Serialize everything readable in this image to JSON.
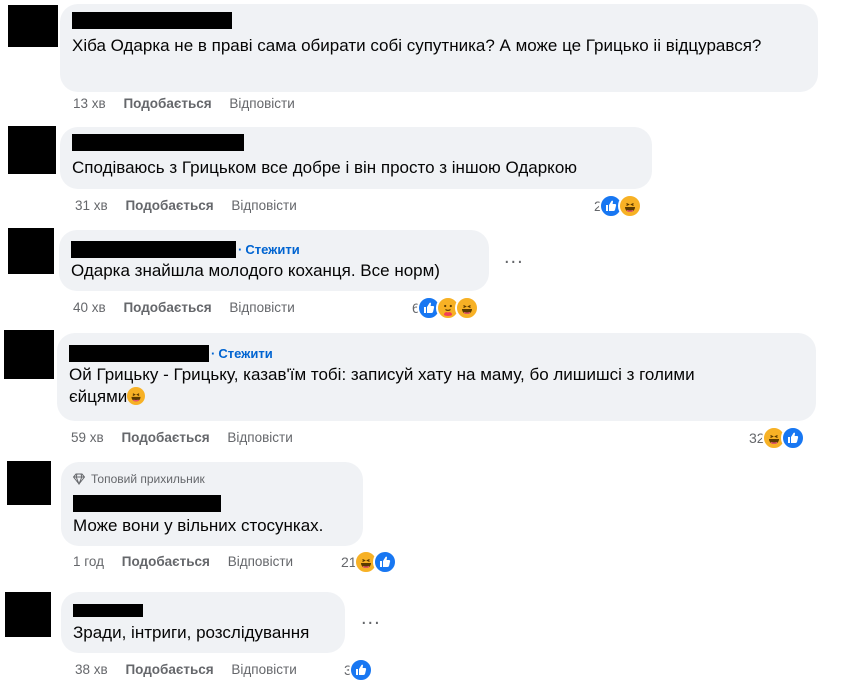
{
  "comments": [
    {
      "text": "Хіба Одарка не в праві сама обирати собі супутника? А може це Грицько іі відцурався?",
      "time": "13 хв",
      "like": "Подобається",
      "reply": "Відповісти"
    },
    {
      "text": "Сподіваюсь з Грицьком все добре і він просто з іншою Одаркою",
      "time": "31 хв",
      "like": "Подобається",
      "reply": "Відповісти",
      "reactions": {
        "count": "2",
        "icons": [
          "like-icon",
          "haha-icon"
        ]
      }
    },
    {
      "follow": "Стежити",
      "text": "Одарка знайшла молодого коханця. Все норм)",
      "time": "40 хв",
      "like": "Подобається",
      "reply": "Відповісти",
      "reactions": {
        "count": "6",
        "icons": [
          "like-icon",
          "care-icon",
          "haha-icon"
        ]
      }
    },
    {
      "follow": "Стежити",
      "text_line1": "Ой Грицьку - Грицьку, казав'їм тобі: записуй хату на маму, бо лишишсі з голими",
      "text_line2": "єйцями",
      "time": "59 хв",
      "like": "Подобається",
      "reply": "Відповісти",
      "reactions": {
        "count": "32",
        "icons": [
          "haha-icon",
          "like-icon"
        ]
      }
    },
    {
      "badge": "Топовий прихильник",
      "text": "Може вони у вільних стосунках.",
      "time": "1 год",
      "like": "Подобається",
      "reply": "Відповісти",
      "reactions": {
        "count": "21",
        "icons": [
          "haha-icon",
          "like-icon"
        ]
      }
    },
    {
      "text": "Зради, інтриги, розслідування",
      "time": "38 хв",
      "like": "Подобається",
      "reply": "Відповісти",
      "reactions": {
        "count": "3",
        "icons": [
          "like-icon"
        ]
      }
    }
  ],
  "more_options": "...",
  "colors": {
    "bubble": "#f0f2f5",
    "link": "#0064d1",
    "meta": "#65676b",
    "like": "#1877f2",
    "haha": "#f7b125"
  }
}
